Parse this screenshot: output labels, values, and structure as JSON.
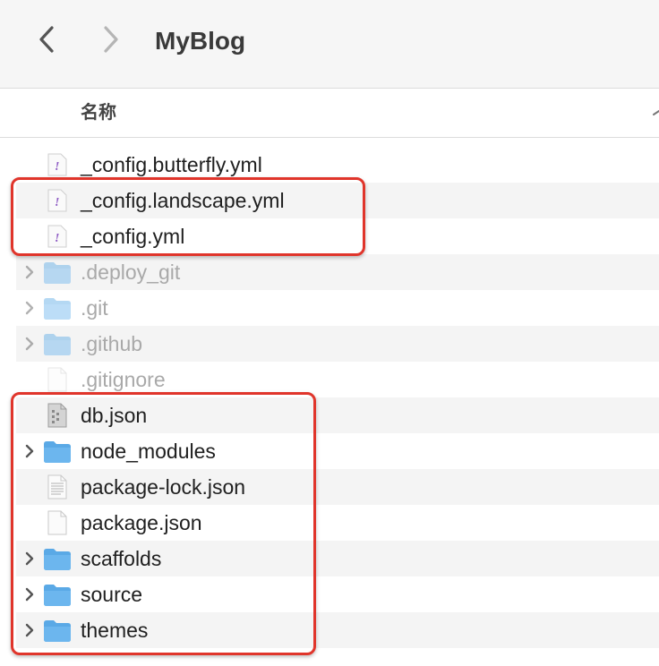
{
  "window": {
    "title": "MyBlog",
    "back_icon": "chevron-left-icon",
    "forward_icon": "chevron-right-icon"
  },
  "columns": {
    "name_header": "名称"
  },
  "files": [
    {
      "name": "_config.butterfly.yml",
      "kind": "yaml",
      "dimmed": false,
      "alt": false
    },
    {
      "name": "_config.landscape.yml",
      "kind": "yaml",
      "dimmed": false,
      "alt": true
    },
    {
      "name": "_config.yml",
      "kind": "yaml",
      "dimmed": false,
      "alt": false
    },
    {
      "name": ".deploy_git",
      "kind": "folder",
      "dimmed": true,
      "alt": true
    },
    {
      "name": ".git",
      "kind": "folder",
      "dimmed": true,
      "alt": false
    },
    {
      "name": ".github",
      "kind": "folder",
      "dimmed": true,
      "alt": true
    },
    {
      "name": ".gitignore",
      "kind": "document",
      "dimmed": true,
      "alt": false
    },
    {
      "name": "db.json",
      "kind": "json-gray",
      "dimmed": false,
      "alt": true
    },
    {
      "name": "node_modules",
      "kind": "folder",
      "dimmed": false,
      "alt": false
    },
    {
      "name": "package-lock.json",
      "kind": "document-lines",
      "dimmed": false,
      "alt": true
    },
    {
      "name": "package.json",
      "kind": "document",
      "dimmed": false,
      "alt": false
    },
    {
      "name": "scaffolds",
      "kind": "folder",
      "dimmed": false,
      "alt": true
    },
    {
      "name": "source",
      "kind": "folder",
      "dimmed": false,
      "alt": false
    },
    {
      "name": "themes",
      "kind": "folder",
      "dimmed": false,
      "alt": true
    }
  ],
  "colors": {
    "highlight": "#e0352b",
    "folder": "#5aa9e6",
    "yaml_mark": "#8e5bc4"
  }
}
